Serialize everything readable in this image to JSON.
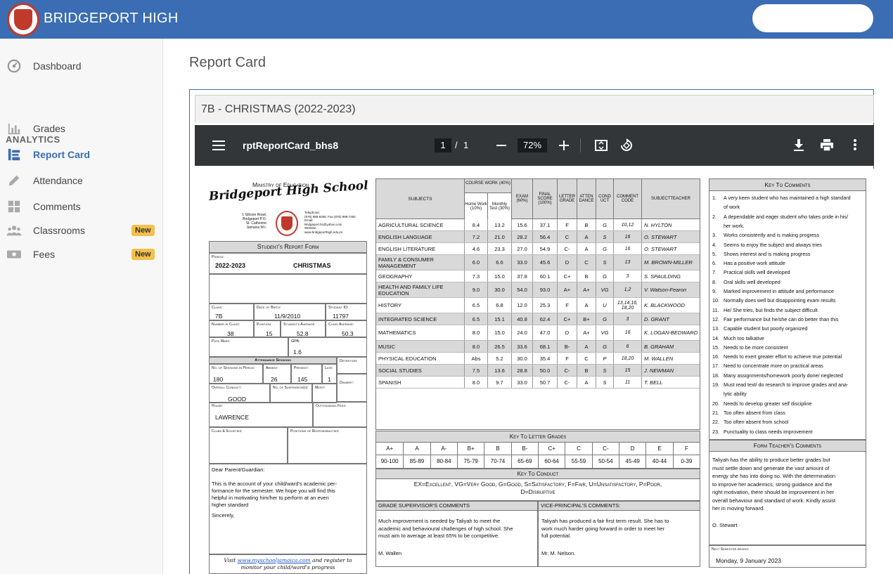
{
  "app": {
    "title": "BRIDGEPORT HIGH"
  },
  "sidebar": {
    "items": [
      {
        "label": "Dashboard"
      },
      {
        "label": "Grades"
      },
      {
        "label": "Report Card"
      },
      {
        "label": "Attendance"
      },
      {
        "label": "Comments"
      },
      {
        "label": "Classrooms",
        "badge": "New"
      },
      {
        "label": "Fees",
        "badge": "New"
      }
    ],
    "section": "ANALYTICS"
  },
  "page": {
    "title": "Report Card",
    "panel_title": "7B - CHRISTMAS (2022-2023)"
  },
  "viewer": {
    "filename": "rptReportCard_bhs8",
    "page_current": "1",
    "page_sep": "/",
    "page_total": "1",
    "zoom": "72%"
  },
  "report": {
    "ministry": "Ministry of Education",
    "school": "Bridgeport High School",
    "address": [
      "1 Gibson Road,",
      "Bridgeport P.O.",
      "St. Catherine",
      "Jamaica W.I."
    ],
    "contact": [
      "Telephone:",
      "(876) 988-8466; Fax (876) 988-7482",
      "Email:",
      "Bridgeport.hs@yahoo.com",
      "Website:",
      "www.bridgeporthigh.edu.jm"
    ],
    "form_title": "Student's Report Form",
    "labels": {
      "period": "Period:",
      "class": "Class:",
      "dob": "Date of Birth:",
      "student_id": "Student ID:",
      "num_in_class": "Number in Class:",
      "position": "Position:",
      "student_avg": "Student's Average:",
      "class_avg": "Class Average:",
      "pass_mark": "Pass Mark:",
      "gpa": "GPA:",
      "attendance": "Attendance Sessions",
      "detention": "Detention:",
      "sessions": "No. of Sessions in Period:",
      "absent": "Absent:",
      "present": "Present:",
      "late": "Late:",
      "conduct": "Overall Conduct:",
      "suspension": "No. of Suspension(s):",
      "merit": "Merit:",
      "demerit": "Demerit:",
      "house": "House:",
      "fees": "Outstanding Fees:",
      "clubs": "Clubs & Societies:",
      "positions": "Positions of Responsibilities:"
    },
    "values": {
      "period": "2022-2023",
      "term": "CHRISTMAS",
      "class": "7B",
      "dob": "11/9/2010",
      "student_id": "11797",
      "num_in_class": "38",
      "position": "15",
      "student_avg": "52.8",
      "class_avg": "50.3",
      "gpa": "1.6",
      "sessions": "180",
      "absent": "26",
      "present": "145",
      "late": "1",
      "conduct": "GOOD",
      "house": "LAWRENCE"
    },
    "letter": [
      "Dear Parent/Guardian:",
      "This is the account of your child/ward's academic per-",
      "formance for the semester.  We hope you will find this",
      "helpful in motivating him/her to perform at an even",
      "higher standard",
      "Sincerely,"
    ],
    "footer": {
      "visit": "Visit",
      "url": "www.myschooljamaica.com",
      "rest": "and register to",
      "line2": "monitor your child/ward's progress"
    },
    "grade_headers": {
      "subjects": "SUBJECTS",
      "course_work": "COURSE WORK (40%)",
      "home_work": "Home Work (10%)",
      "monthly": "Monthly Test (30%)",
      "exam": "EXAM (60%)",
      "final": "FINAL SCORE (100%)",
      "letter": "LETTER GRADE",
      "attendance": "ATTEN DANCE",
      "conduct": "COND UCT",
      "comment": "COMMENT CODE",
      "teacher": "SUBJECTTEACHER"
    },
    "grades": [
      [
        "AGRICULTURAL SCIENCE",
        "8.4",
        "13.2",
        "15.6",
        "37.1",
        "F",
        "B",
        "G",
        "10,12",
        "N. HYLTON"
      ],
      [
        "ENGLISH LANGUAGE",
        "7.2",
        "21.0",
        "28.2",
        "56.4",
        "C",
        "A",
        "S",
        "16",
        "O. STEWART"
      ],
      [
        "ENGLISH LITERATURE",
        "4.6",
        "23.3",
        "27.0",
        "54.9",
        "C-",
        "A",
        "G",
        "16",
        "O. STEWART"
      ],
      [
        "FAMILY & CONSUMER MANAGEMENT",
        "6.0",
        "6.6",
        "33.0",
        "45.6",
        "D",
        "C",
        "S",
        "13",
        "M. BROWN-MILLER"
      ],
      [
        "GEOGRAPHY",
        "7.3",
        "15.0",
        "37.8",
        "60.1",
        "C+",
        "B",
        "G",
        "3",
        "S. SPAULDING"
      ],
      [
        "HEALTH AND FAMILY LIFE EDUCATION",
        "9.0",
        "30.0",
        "54.0",
        "93.0",
        "A+",
        "A+",
        "VG",
        "1,2",
        "V. Watson-Fearon"
      ],
      [
        "HISTORY",
        "6.5",
        "6.8",
        "12.0",
        "25.3",
        "F",
        "A",
        "U",
        "13,14,16, 18,20",
        "K. BLACKWOOD"
      ],
      [
        "INTEGRATED SCIENCE",
        "6.5",
        "15.1",
        "40.8",
        "62.4",
        "C+",
        "B+",
        "G",
        "3",
        "D. GRANT"
      ],
      [
        "MATHEMATICS",
        "8.0",
        "15.0",
        "24.0",
        "47.0",
        "D",
        "A+",
        "VG",
        "16",
        "K. LOGAN-BEDWARD"
      ],
      [
        "MUSIC",
        "8.0",
        "26.5",
        "33.6",
        "68.1",
        "B-",
        "A",
        "G",
        "6",
        "B. GRAHAM"
      ],
      [
        "PHYSICAL EDUCATION",
        "Abs",
        "5.2",
        "30.0",
        "35.4",
        "F",
        "C",
        "P",
        "18,20",
        "M. WALLEN"
      ],
      [
        "SOCIAL STUDIES",
        "7.5",
        "13.6",
        "28.8",
        "50.0",
        "C-",
        "B",
        "S",
        "15",
        "J. NEWMAN"
      ],
      [
        "SPANISH",
        "8.0",
        "9.7",
        "33.0",
        "50.7",
        "C-",
        "A",
        "S",
        "11",
        "T. BELL"
      ]
    ],
    "key_letter": {
      "title": "Key To Letter Grades",
      "grades": [
        "A+",
        "A",
        "A-",
        "B+",
        "B",
        "B-",
        "C+",
        "C",
        "C-",
        "D",
        "E",
        "F"
      ],
      "ranges": [
        "90-100",
        "85-89",
        "80-84",
        "75-79",
        "70-74",
        "65-69",
        "60-64",
        "55-59",
        "50-54",
        "45-49",
        "40-44",
        "0-39"
      ]
    },
    "key_conduct": {
      "title": "Key To Conduct",
      "line1": "EX=Excellent, VG=Very Good, G=Good, S=Satisfactory, F=Fair, U=Unsatisfactory, P=Poor,",
      "line2": "D=Disruptive"
    },
    "supervisor": {
      "title": "GRADE SUPERVISOR'S COMMENTS",
      "text": [
        "Much improvement is needed by Taliyah to meet the",
        "academic and behavioural challenges of high school. She",
        "must aim to average at least 65% to be competitive."
      ],
      "sign": "M. Wallen"
    },
    "vp": {
      "title": "VICE-PRINCIPAL'S COMMENTS:",
      "text": [
        "Taliyah has produced a fair first term result. She has to",
        "work much harder going forward in order to meet her",
        "full potential."
      ],
      "sign": "Mr. M. Nelson."
    },
    "key_comments": {
      "title": "Key To Comments",
      "items": [
        [
          "1.",
          "A very keen student who has maintained a high standard"
        ],
        [
          "",
          "of work"
        ],
        [
          "2.",
          "A dependable and eager student who takes pride in his/"
        ],
        [
          "",
          "her work."
        ],
        [
          "3.",
          "Works consistently and is making progress"
        ],
        [
          "4.",
          "Seems to enjoy the subject and always tries"
        ],
        [
          "5.",
          "Shows interest and is making progress"
        ],
        [
          "6.",
          "Has a positive work attitude"
        ],
        [
          "7.",
          "Practical skills well developed"
        ],
        [
          "8.",
          "Oral skills well developed"
        ],
        [
          "9.",
          "Marked improvement in attitude and performance"
        ],
        [
          "10.",
          "Normally does well but disappointing exam results"
        ],
        [
          "11.",
          "He/ She tries, but finds the subject difficult"
        ],
        [
          "12.",
          "Fair performance but he/she can do better than this"
        ],
        [
          "13.",
          "Capable student but poorly organized"
        ],
        [
          "14.",
          "Much too talkative"
        ],
        [
          "15.",
          "Needs to be more consistent"
        ],
        [
          "16.",
          "Needs to exert greater effort to achieve true potential"
        ],
        [
          "17.",
          "Need to concentrate more on practical areas"
        ],
        [
          "18.",
          "Many assignments/homework poorly done/ neglected"
        ],
        [
          "19.",
          "Must read text/ do research to improve grades and ana-"
        ],
        [
          "",
          "lytic ability"
        ],
        [
          "20.",
          "Needs to develop greater self discipline"
        ],
        [
          "21.",
          "Too often absent from class"
        ],
        [
          "22.",
          "Too often absent from school"
        ],
        [
          "23.",
          "Punctuality to class needs improvement"
        ]
      ]
    },
    "form_teacher": {
      "title": "Form Teacher's Comments",
      "text": [
        "Taliyah has the ability to produce better grades but",
        "must settle down and generate the vast amount of",
        "energy she has into doing so. With the determination",
        "to improve her academics, strong guidance and the",
        "right motivation, there should be improvement in her",
        "overall behaviour and standard of work. Kindly assist",
        "her in moving forward."
      ],
      "sign": "O. Stewart"
    },
    "next_semester": {
      "label": "Next Semester begins:",
      "date": "Monday, 9 January 2023"
    }
  },
  "colors": {
    "topbar": "#3a6db3",
    "toolbar": "#323639",
    "badge": "#f4c04c"
  }
}
